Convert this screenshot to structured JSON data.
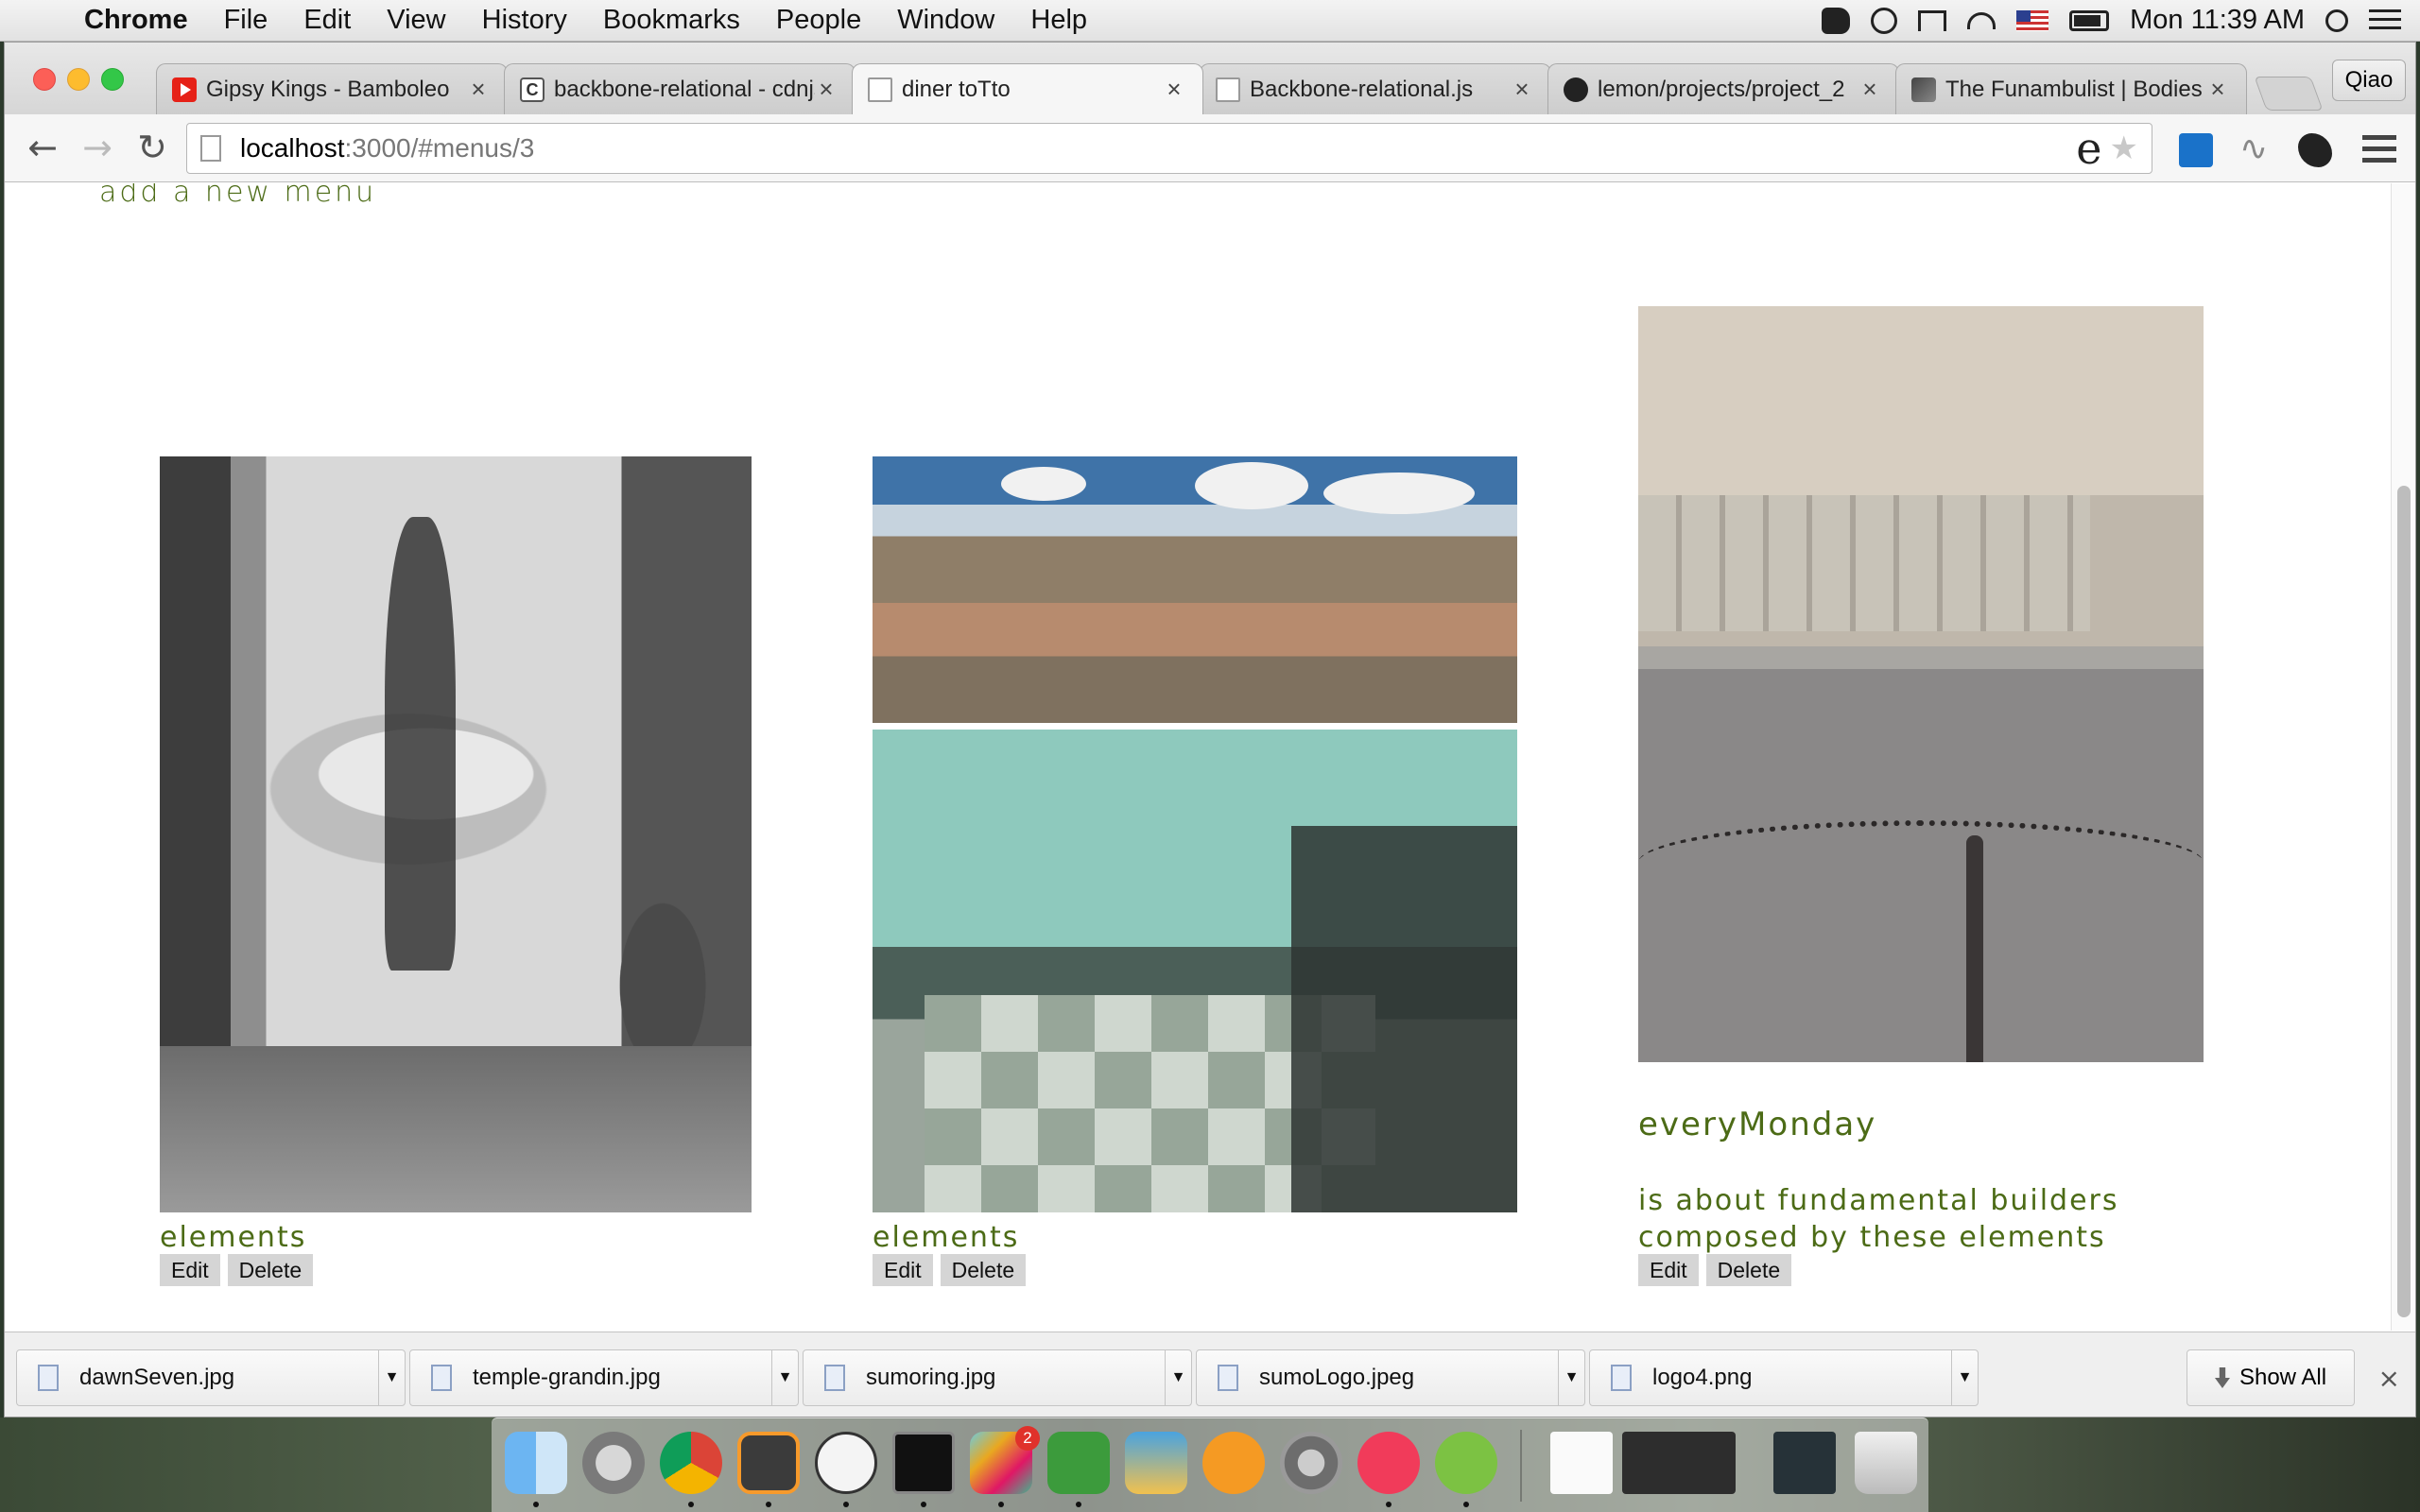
{
  "menubar": {
    "app": "Chrome",
    "items": [
      "File",
      "Edit",
      "View",
      "History",
      "Bookmarks",
      "People",
      "Window",
      "Help"
    ],
    "clock": "Mon 11:39 AM",
    "status_icons": [
      "evernote-icon",
      "do-not-disturb-icon",
      "airplay-icon",
      "wifi-icon",
      "us-flag-icon",
      "battery-icon",
      "spotlight-icon",
      "notification-list-icon"
    ]
  },
  "browser": {
    "tabs": [
      {
        "title": "Gipsy Kings - Bamboleo",
        "icon": "youtube-icon",
        "active": false
      },
      {
        "title": "backbone-relational - cdnjs",
        "icon": "cdnjs-icon",
        "active": false
      },
      {
        "title": "diner toTto",
        "icon": "page-icon",
        "active": true
      },
      {
        "title": "Backbone-relational.js",
        "icon": "page-icon",
        "active": false
      },
      {
        "title": "lemon/projects/project_2",
        "icon": "github-icon",
        "active": false
      },
      {
        "title": "The Funambulist | Bodies",
        "icon": "image-icon",
        "active": false
      }
    ],
    "profile": "Qiao",
    "url": {
      "host": "localhost",
      "path": ":3000/#menus/3"
    },
    "omnibox_ext_glyph": "e"
  },
  "page": {
    "add_menu_link": "add a new menu",
    "cards": [
      {
        "title": "elements",
        "description": "",
        "edit": "Edit",
        "delete": "Delete"
      },
      {
        "title": "elements",
        "description": "",
        "edit": "Edit",
        "delete": "Delete"
      },
      {
        "title": "everyMonday",
        "description": "is about fundamental builders composed by these elements",
        "edit": "Edit",
        "delete": "Delete"
      }
    ]
  },
  "downloads": {
    "files": [
      "dawnSeven.jpg",
      "temple-grandin.jpg",
      "sumoring.jpg",
      "sumoLogo.jpeg",
      "logo4.png"
    ],
    "show_all": "Show All"
  },
  "dock": {
    "apps": [
      "finder-icon",
      "launchpad-icon",
      "chrome-icon",
      "sublime-text-icon",
      "smile-icon",
      "terminal-icon",
      "slack-icon",
      "evernote-icon",
      "iphoto-icon",
      "ibooks-icon",
      "system-preferences-icon",
      "itunes-icon",
      "spotify-icon"
    ],
    "slack_badge": "2"
  }
}
